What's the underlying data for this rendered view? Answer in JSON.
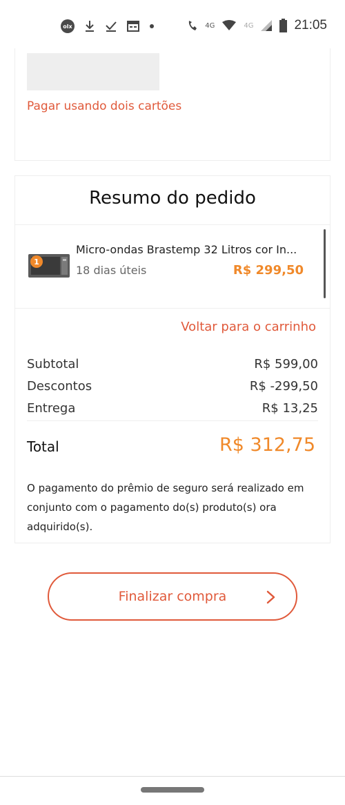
{
  "status_bar": {
    "time": "21:05",
    "left_icons": [
      "olx-icon",
      "download-icon",
      "checkmark-icon",
      "calendar-icon",
      "dot-icon"
    ],
    "olx_badge": "olx",
    "network_label_1": "4G",
    "network_label_2": "4G",
    "right_icons": [
      "wifi-call-icon",
      "wifi-icon",
      "signal-icon",
      "battery-icon"
    ]
  },
  "payment_card": {
    "two_cards_link": "Pagar usando dois cartões"
  },
  "summary": {
    "title": "Resumo do pedido",
    "item": {
      "name": "Micro-ondas Brastemp 32 Litros cor In...",
      "delivery": "18 dias úteis",
      "price": "R$ 299,50",
      "quantity": "1"
    },
    "back_to_cart": "Voltar para o carrinho",
    "subtotal_label": "Subtotal",
    "subtotal_value": "R$ 599,00",
    "discounts_label": "Descontos",
    "discounts_value": "R$ -299,50",
    "delivery_label": "Entrega",
    "delivery_value": "R$ 13,25",
    "total_label": "Total",
    "total_value": "R$ 312,75",
    "insurance_note": "O pagamento do prêmio de seguro será realizado em conjunto com o pagamento do(s) produto(s) ora adquirido(s)."
  },
  "actions": {
    "finalize_label": "Finalizar compra"
  },
  "colors": {
    "accent_red": "#e0593a",
    "accent_orange": "#f0892a"
  }
}
